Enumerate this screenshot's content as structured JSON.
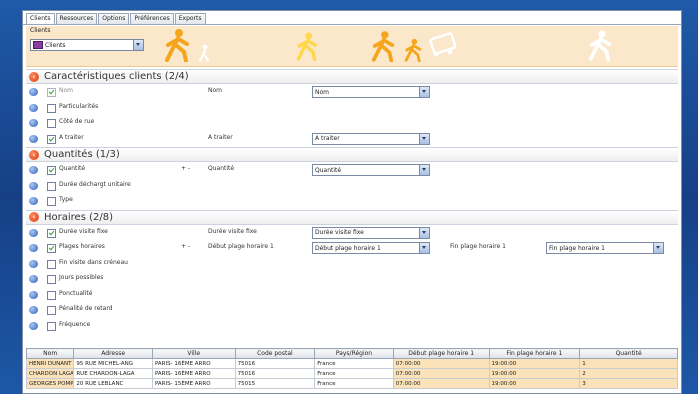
{
  "tabs": [
    "Clients",
    "Ressources",
    "Options",
    "Préférences",
    "Exports"
  ],
  "banner": {
    "label": "Clients",
    "select_value": "Clients"
  },
  "sections": [
    {
      "title": "Caractéristiques clients (2/4)",
      "rows": [
        {
          "label": "Nom",
          "checked": true,
          "disabled": true,
          "field_label": "Nom",
          "value": "Nom"
        },
        {
          "label": "Particularités",
          "checked": false
        },
        {
          "label": "Côté de rue",
          "checked": false
        },
        {
          "label": "A traiter",
          "checked": true,
          "field_label": "A traiter",
          "value": "A traiter"
        }
      ]
    },
    {
      "title": "Quantités (1/3)",
      "rows": [
        {
          "label": "Quantité",
          "checked": true,
          "plusminus": "+  -",
          "field_label": "Quantité",
          "value": "Quantité"
        },
        {
          "label": "Durée déchargt unitaire",
          "checked": false
        },
        {
          "label": "Type",
          "checked": false
        }
      ]
    },
    {
      "title": "Horaires (2/8)",
      "rows": [
        {
          "label": "Durée visite fixe",
          "checked": true,
          "field_label": "Durée visite fixe",
          "value": "Durée visite fixe"
        },
        {
          "label": "Plages horaires",
          "checked": true,
          "plusminus": "+  -",
          "field_label": "Début plage horaire 1",
          "value": "Début plage horaire 1",
          "field_label2": "Fin plage horaire 1",
          "value2": "Fin plage horaire 1"
        },
        {
          "label": "Fin visite dans créneau",
          "checked": false
        },
        {
          "label": "Jours possibles",
          "checked": false
        },
        {
          "label": "Ponctualité",
          "checked": false
        },
        {
          "label": "Pénalité de retard",
          "checked": false
        },
        {
          "label": "Fréquence",
          "checked": false
        }
      ]
    }
  ],
  "table": {
    "columns": [
      "Nom",
      "Adresse",
      "Ville",
      "Code postal",
      "Pays/Région",
      "Début plage horaire 1",
      "Fin plage horaire 1",
      "Quantité"
    ],
    "rows": [
      [
        "HENRI DUNANT",
        "95 RUE MICHEL-ANG",
        "PARIS- 16ÈME ARRO",
        "75016",
        "France",
        "07:00:00",
        "19:00:00",
        "1"
      ],
      [
        "CHARDON LAGACHE",
        "RUE CHARDON-LAGA",
        "PARIS- 16ÈME ARRO",
        "75016",
        "France",
        "07:00:00",
        "19:00:00",
        "2"
      ],
      [
        "GEORGES POMPIDO",
        "20 RUE LEBLANC",
        "PARIS- 15ÈME ARRO",
        "75015",
        "France",
        "07:00:00",
        "19:00:00",
        "3"
      ]
    ]
  },
  "colors": {
    "accent": "#fbe7c9",
    "section_icon": "#d83c13",
    "bullet": "#2d5fbe",
    "walker_orange": "#f4a51c",
    "walker_yellow": "#ffd84a"
  }
}
